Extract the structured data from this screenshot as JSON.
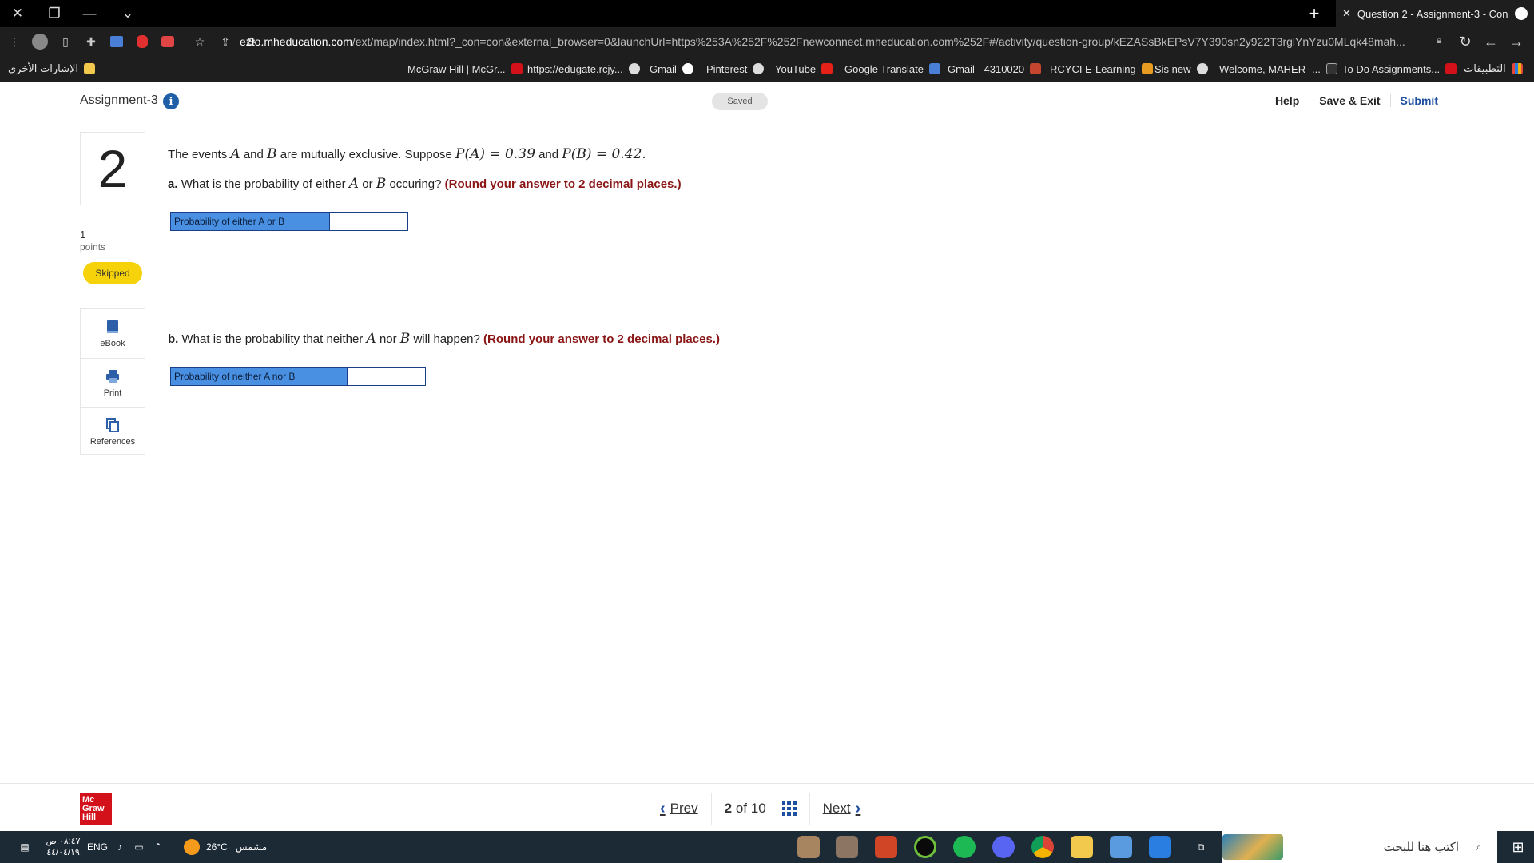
{
  "browser": {
    "tab_title": "Question 2 - Assignment-3 - Con",
    "url_host": "ezto.mheducation.com",
    "url_path": "/ext/map/index.html?_con=con&external_browser=0&launchUrl=https%253A%252F%252Fnewconnect.mheducation.com%252F#/activity/question-group/kEZASsBkEPsV7Y390sn2y922T3rglYnYzu0MLqk48mah...",
    "bookmarks": [
      "McGraw Hill | McGr...",
      "https://edugate.rcjy...",
      "Gmail",
      "Pinterest",
      "YouTube",
      "Google Translate",
      "Gmail - 4310020",
      "RCYCI E-Learning",
      "Sis new",
      "Welcome, MAHER -...",
      "To Do Assignments...",
      "التطبيقات"
    ],
    "other_bookmarks": "الإشارات الأخرى"
  },
  "header": {
    "assignment_title": "Assignment-3",
    "saved_status": "Saved",
    "help": "Help",
    "save_exit": "Save & Exit",
    "submit": "Submit"
  },
  "question": {
    "number": "2",
    "points_value": "1",
    "points_label": "points",
    "status": "Skipped",
    "intro_prefix": "The events",
    "var_a": "A",
    "and": "and",
    "var_b": "B",
    "intro_mid": "are mutually exclusive. Suppose",
    "pa_expr": "P(A) = 0.39",
    "pb_expr": "P(B) = 0.42.",
    "part_a": {
      "letter": "a.",
      "text_prefix": "What is the probability of either",
      "or": "or",
      "text_suffix": "occuring?",
      "instruction": "(Round your answer to 2 decimal places.)",
      "answer_label": "Probability of either A or B",
      "answer_value": ""
    },
    "part_b": {
      "letter": "b.",
      "text_prefix": "What is the probability that neither",
      "nor": "nor",
      "text_suffix": "will happen?",
      "instruction": "(Round your answer to 2 decimal places.)",
      "answer_label": "Probability of neither A nor B",
      "answer_value": ""
    }
  },
  "tools": {
    "ebook": "eBook",
    "print": "Print",
    "references": "References"
  },
  "footer": {
    "logo_lines": [
      "Mc",
      "Graw",
      "Hill"
    ],
    "prev": "Prev",
    "current": "2",
    "of_total": "of 10",
    "next": "Next"
  },
  "taskbar": {
    "search_placeholder": "اكتب هنا للبحث",
    "weather_temp": "26°C",
    "weather_desc": "مشمس",
    "language": "ENG",
    "time": "٠٨:٤٧ ص",
    "date": "٤٤/٠٤/١٩"
  },
  "colors": {
    "brand_red": "#d3111a",
    "accent_blue": "#1f4fa0",
    "answer_label_bg": "#4a90e2",
    "skipped_yellow": "#f6d20a",
    "instruction_red": "#8a1515"
  }
}
